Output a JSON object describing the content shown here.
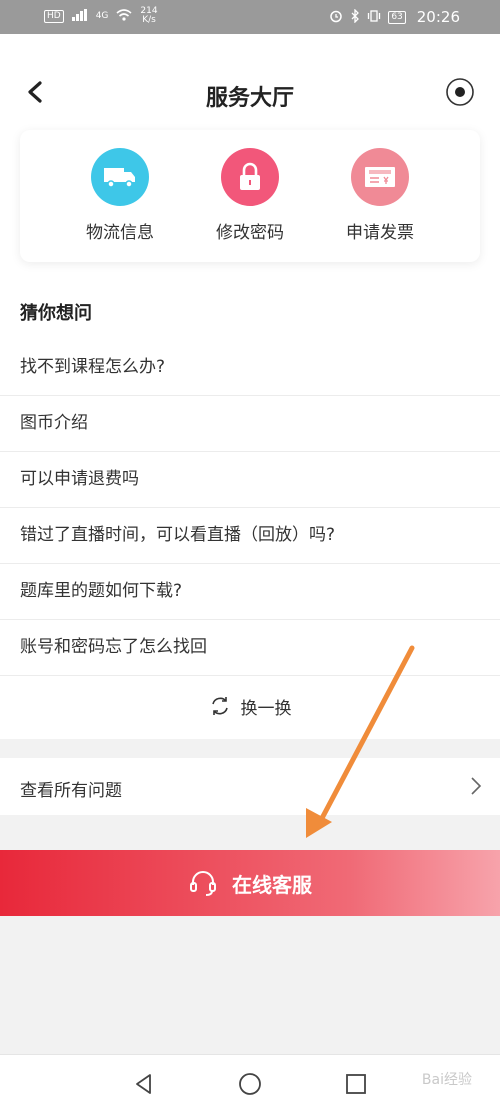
{
  "status_bar": {
    "hd_tag": "HD",
    "net_tag": "4G",
    "speed_value": "214",
    "speed_unit": "K/s",
    "battery": "63",
    "time": "20:26"
  },
  "header": {
    "title": "服务大厅"
  },
  "shortcuts": [
    {
      "label": "物流信息",
      "icon": "truck-icon",
      "color": "#3ec7e8"
    },
    {
      "label": "修改密码",
      "icon": "lock-icon",
      "color": "#f2577a"
    },
    {
      "label": "申请发票",
      "icon": "invoice-icon",
      "color": "#f08a96"
    }
  ],
  "faq": {
    "title": "猜你想问",
    "items": [
      "找不到课程怎么办?",
      "图币介绍",
      "可以申请退费吗",
      "错过了直播时间，可以看直播（回放）吗?",
      "题库里的题如何下载?",
      "账号和密码忘了怎么找回"
    ],
    "refresh_label": "换一换"
  },
  "all_questions": {
    "label": "查看所有问题"
  },
  "online_service": {
    "label": "在线客服"
  },
  "watermark": "Bai经验",
  "colors": {
    "accent_red": "#e8283a",
    "arrow_orange": "#f08c3a"
  }
}
